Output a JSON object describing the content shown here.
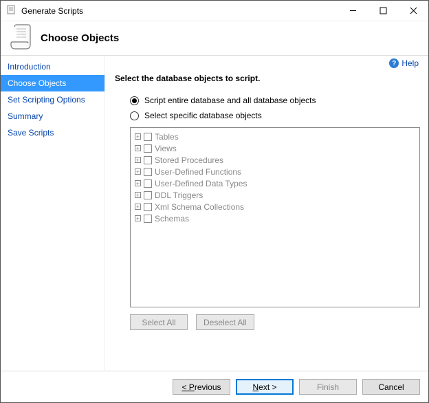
{
  "window": {
    "title": "Generate Scripts"
  },
  "header": {
    "title": "Choose Objects"
  },
  "help": {
    "label": "Help"
  },
  "sidebar": {
    "items": [
      {
        "label": "Introduction"
      },
      {
        "label": "Choose Objects"
      },
      {
        "label": "Set Scripting Options"
      },
      {
        "label": "Summary"
      },
      {
        "label": "Save Scripts"
      }
    ]
  },
  "main": {
    "instruction": "Select the database objects to script.",
    "radio_entire": "Script entire database and all database objects",
    "radio_specific": "Select specific database objects",
    "tree": [
      "Tables",
      "Views",
      "Stored Procedures",
      "User-Defined Functions",
      "User-Defined Data Types",
      "DDL Triggers",
      "Xml Schema Collections",
      "Schemas"
    ],
    "select_all": "Select All",
    "deselect_all": "Deselect All"
  },
  "footer": {
    "previous": "< Previous",
    "next": "Next >",
    "finish": "Finish",
    "cancel": "Cancel"
  }
}
